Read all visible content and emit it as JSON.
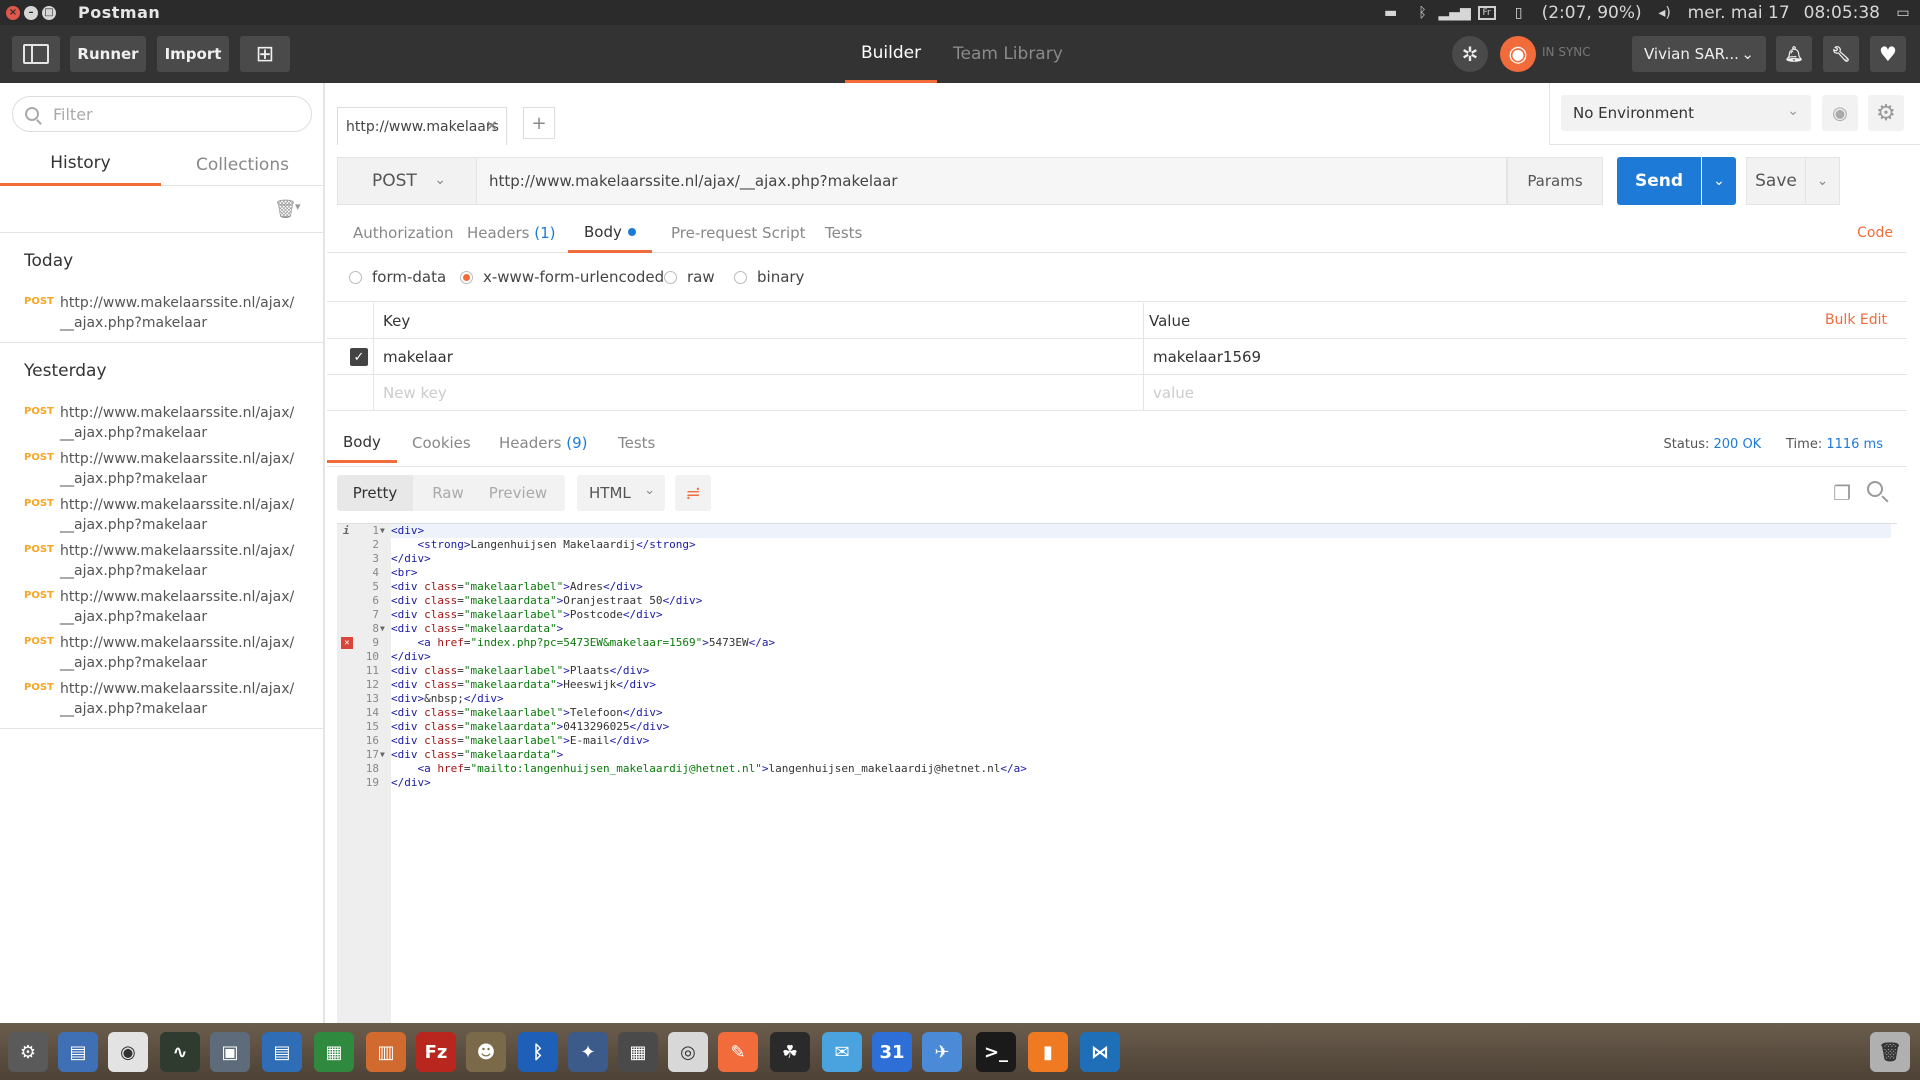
{
  "os": {
    "title": "Postman",
    "battery": "(2:07, 90%)",
    "date": "mer. mai 17",
    "time": "08:05:38",
    "kbd": "Fr"
  },
  "header": {
    "runner": "Runner",
    "import": "Import",
    "tabs": [
      "Builder",
      "Team Library"
    ],
    "sync": "IN SYNC",
    "user": "Vivian SAR..."
  },
  "sidebar": {
    "filter_placeholder": "Filter",
    "tabs": [
      "History",
      "Collections"
    ],
    "sections": [
      {
        "title": "Today",
        "items": [
          {
            "method": "POST",
            "url": "http://www.makelaarssite.nl/ajax/__ajax.php?makelaar"
          }
        ]
      },
      {
        "title": "Yesterday",
        "items": [
          {
            "method": "POST",
            "url": "http://www.makelaarssite.nl/ajax/__ajax.php?makelaar"
          },
          {
            "method": "POST",
            "url": "http://www.makelaarssite.nl/ajax/__ajax.php?makelaar"
          },
          {
            "method": "POST",
            "url": "http://www.makelaarssite.nl/ajax/__ajax.php?makelaar"
          },
          {
            "method": "POST",
            "url": "http://www.makelaarssite.nl/ajax/__ajax.php?makelaar"
          },
          {
            "method": "POST",
            "url": "http://www.makelaarssite.nl/ajax/__ajax.php?makelaar"
          },
          {
            "method": "POST",
            "url": "http://www.makelaarssite.nl/ajax/__ajax.php?makelaar"
          },
          {
            "method": "POST",
            "url": "http://www.makelaarssite.nl/ajax/__ajax.php?makelaar"
          }
        ]
      }
    ]
  },
  "request": {
    "tab_title": "http://www.makelaars",
    "environment": "No Environment",
    "method": "POST",
    "url": "http://www.makelaarssite.nl/ajax/__ajax.php?makelaar",
    "params": "Params",
    "send": "Send",
    "save": "Save",
    "tabs": {
      "authorization": "Authorization",
      "headers": "Headers",
      "headers_count": "(1)",
      "body": "Body",
      "prerequest": "Pre-request Script",
      "tests": "Tests"
    },
    "code_link": "Code",
    "body_types": [
      "form-data",
      "x-www-form-urlencoded",
      "raw",
      "binary"
    ],
    "selected_body_type": "x-www-form-urlencoded",
    "table": {
      "key_header": "Key",
      "value_header": "Value",
      "bulk_edit": "Bulk Edit",
      "rows": [
        {
          "key": "makelaar",
          "value": "makelaar1569",
          "checked": true
        }
      ],
      "new_key_placeholder": "New key",
      "new_value_placeholder": "value"
    }
  },
  "response": {
    "tabs": {
      "body": "Body",
      "cookies": "Cookies",
      "headers": "Headers",
      "headers_count": "(9)",
      "tests": "Tests"
    },
    "status_label": "Status:",
    "status": "200 OK",
    "time_label": "Time:",
    "time": "1116 ms",
    "views": [
      "Pretty",
      "Raw",
      "Preview"
    ],
    "format": "HTML",
    "code": [
      "<div>",
      "    <strong>Langenhuijsen Makelaardij</strong>",
      "</div>",
      "<br>",
      "<div class=\"makelaarlabel\">Adres</div>",
      "<div class=\"makelaardata\">Oranjestraat 50</div>",
      "<div class=\"makelaarlabel\">Postcode</div>",
      "<div class=\"makelaardata\">",
      "    <a href=\"index.php?pc=5473EW&makelaar=1569\">5473EW</a>",
      "</div>",
      "<div class=\"makelaarlabel\">Plaats</div>",
      "<div class=\"makelaardata\">Heeswijk</div>",
      "<div>&nbsp;</div>",
      "<div class=\"makelaarlabel\">Telefoon</div>",
      "<div class=\"makelaardata\">0413296025</div>",
      "<div class=\"makelaarlabel\">E-mail</div>",
      "<div class=\"makelaardata\">",
      "    <a href=\"mailto:langenhuijsen_makelaardij@hetnet.nl\">langenhuijsen_makelaardij@hetnet.nl</a>",
      "</div>"
    ]
  },
  "colors": {
    "accent": "#f26b3a",
    "send": "#1d7bd7",
    "post_method": "#f5a623"
  },
  "dock": [
    "settings-icon",
    "files-icon",
    "chrome-icon",
    "monitor-icon",
    "screenshot-icon",
    "writer-icon",
    "calc-icon",
    "impress-icon",
    "filezilla-icon",
    "gimp-icon",
    "bluetooth-icon",
    "sweeper-icon",
    "workspace-icon",
    "disk-icon",
    "postman-icon",
    "inkscape-icon",
    "mail-icon",
    "calendar-icon",
    "thunderbird-icon",
    "terminal-icon",
    "notes-icon",
    "vscode-icon",
    "trash-icon"
  ]
}
